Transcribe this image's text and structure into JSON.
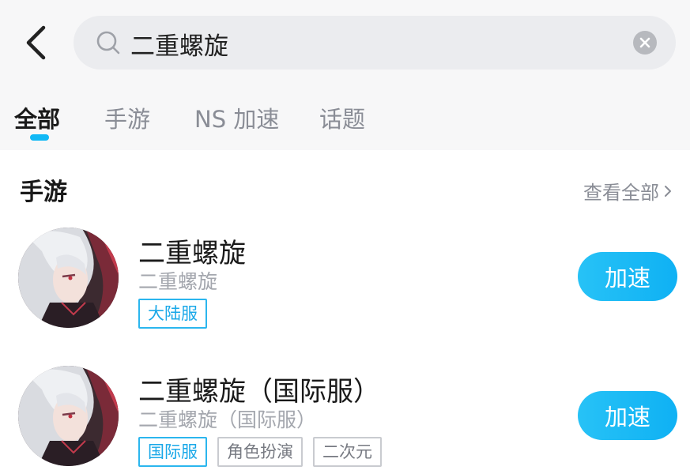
{
  "search": {
    "query": "二重螺旋"
  },
  "tabs": [
    {
      "label": "全部"
    },
    {
      "label": "手游"
    },
    {
      "label": "NS 加速"
    },
    {
      "label": "话题"
    }
  ],
  "section": {
    "title": "手游",
    "view_all": "查看全部"
  },
  "games": [
    {
      "title": "二重螺旋",
      "subtitle": "二重螺旋",
      "tags": [
        "大陆服"
      ],
      "button": "加速"
    },
    {
      "title": "二重螺旋（国际服）",
      "subtitle": "二重螺旋（国际服）",
      "tags": [
        "国际服",
        "角色扮演",
        "二次元"
      ],
      "button": "加速"
    }
  ],
  "colors": {
    "accent": "#11b8f5",
    "button": "#15b6f5",
    "tag_primary": "#2bb6ee"
  }
}
